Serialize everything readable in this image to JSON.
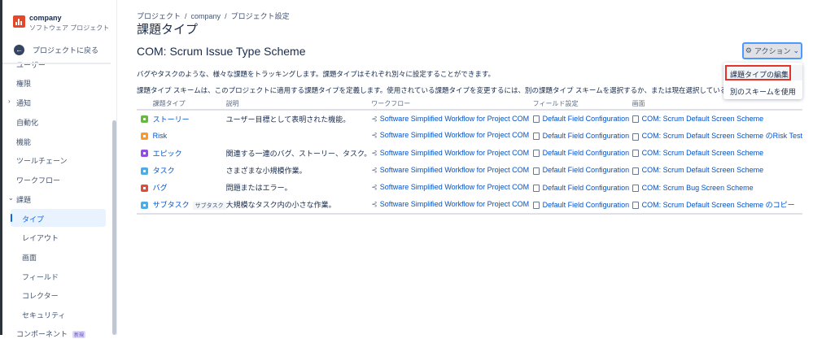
{
  "sidebar": {
    "project_name": "company",
    "project_type": "ソフトウェア プロジェクト",
    "back_label": "プロジェクトに戻る",
    "items": [
      {
        "label": "ユーザー"
      },
      {
        "label": "権限"
      },
      {
        "label": "通知"
      },
      {
        "label": "自動化"
      },
      {
        "label": "機能"
      },
      {
        "label": "ツールチェーン"
      },
      {
        "label": "ワークフロー"
      },
      {
        "label": "課題"
      }
    ],
    "sub_items": [
      {
        "label": "タイプ"
      },
      {
        "label": "レイアウト"
      },
      {
        "label": "画面"
      },
      {
        "label": "フィールド"
      },
      {
        "label": "コレクター"
      },
      {
        "label": "セキュリティ"
      }
    ],
    "last_item": "コンポーネント",
    "new_badge": "新規"
  },
  "breadcrumb": [
    "プロジェクト",
    "company",
    "プロジェクト設定"
  ],
  "page_title": "課題タイプ",
  "scheme_title": "COM: Scrum Issue Type Scheme",
  "desc1": "バグやタスクのような、様々な課題をトラッキングします。課題タイプはそれぞれ別々に設定することができます。",
  "desc2": "課題タイプ スキームは、このプロジェクトに適用する課題タイプを定義します。使用されている課題タイプを変更するには、別の課題タイプ スキームを選択するか、または現在選択しているスキ",
  "actions": {
    "label": "アクション",
    "menu": [
      "課題タイプの編集",
      "別のスキームを使用"
    ]
  },
  "table": {
    "headers": [
      "課題タイプ",
      "説明",
      "ワークフロー",
      "フィールド設定",
      "画面"
    ],
    "rows": [
      {
        "type": "ストーリー",
        "color": "#63ba3c",
        "desc": "ユーザー目標として表明された機能。",
        "workflow": "Software Simplified Workflow for Project COM",
        "field": "Default Field Configuration",
        "screen": "COM: Scrum Default Screen Scheme"
      },
      {
        "type": "Risk",
        "color": "#ff991f",
        "desc": "",
        "workflow": "Software Simplified Workflow for Project COM",
        "field": "Default Field Configuration",
        "screen": "COM: Scrum Default Screen Scheme のRisk Test"
      },
      {
        "type": "エピック",
        "color": "#904ee2",
        "desc": "関連する一連のバグ、ストーリー、タスク。",
        "workflow": "Software Simplified Workflow for Project COM",
        "field": "Default Field Configuration",
        "screen": "COM: Scrum Default Screen Scheme"
      },
      {
        "type": "タスク",
        "color": "#4bade8",
        "desc": "さまざまな小規模作業。",
        "workflow": "Software Simplified Workflow for Project COM",
        "field": "Default Field Configuration",
        "screen": "COM: Scrum Default Screen Scheme"
      },
      {
        "type": "バグ",
        "color": "#e5493a",
        "desc": "問題またはエラー。",
        "workflow": "Software Simplified Workflow for Project COM",
        "field": "Default Field Configuration",
        "screen": "COM: Scrum Bug Screen Scheme"
      },
      {
        "type": "サブタスク",
        "tag": "サブタスク",
        "color": "#4bade8",
        "desc": "大規模なタスク内の小さな作業。",
        "workflow": "Software Simplified Workflow for Project COM",
        "field": "Default Field Configuration",
        "screen": "COM: Scrum Default Screen Scheme のコピー"
      }
    ]
  }
}
